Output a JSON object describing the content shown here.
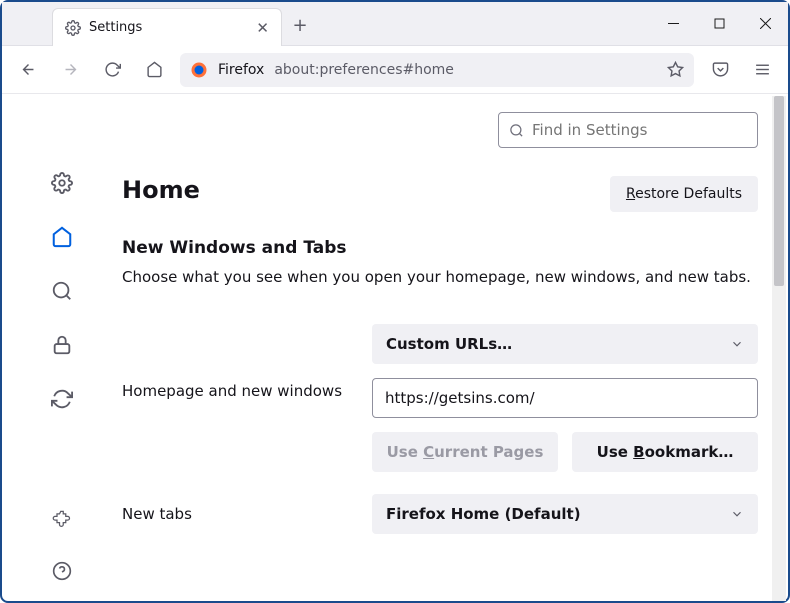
{
  "window": {
    "tab_title": "Settings",
    "url_label": "Firefox",
    "url": "about:preferences#home"
  },
  "search": {
    "placeholder": "Find in Settings"
  },
  "page": {
    "title": "Home",
    "restore_btn_pre": "R",
    "restore_btn_rest": "estore Defaults"
  },
  "section": {
    "heading": "New Windows and Tabs",
    "description": "Choose what you see when you open your homepage, new windows, and new tabs."
  },
  "homepage": {
    "label": "Homepage and new windows",
    "select_value": "Custom URLs…",
    "input_value": "https://getsins.com/",
    "use_current_pre": "Use ",
    "use_current_ul": "C",
    "use_current_post": "urrent Pages",
    "use_bookmark_pre": "Use ",
    "use_bookmark_ul": "B",
    "use_bookmark_post": "ookmark…"
  },
  "newtabs": {
    "label": "New tabs",
    "select_value": "Firefox Home (Default)"
  }
}
